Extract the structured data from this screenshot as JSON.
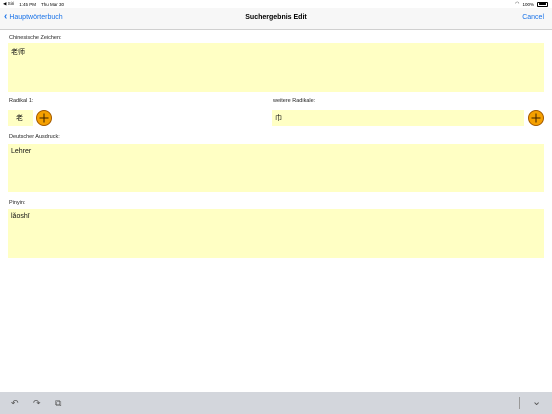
{
  "status_bar": {
    "carrier": "◀ Siri",
    "time": "1:45 PM",
    "date": "Thu Mar 30",
    "battery": "100%"
  },
  "nav": {
    "back_label": "Hauptwörterbuch",
    "title": "Suchergebnis Edit",
    "cancel_label": "Cancel"
  },
  "form": {
    "chinese_label": "Chinesische Zeichen:",
    "chinese_value": "老师",
    "radical1_label": "Radikal 1:",
    "radical1_value": "老",
    "more_radicals_label": "weitere Radikale:",
    "more_radicals_value": "巾",
    "german_label": "Deutscher Ausdruck:",
    "german_value": "Lehrer",
    "pinyin_label": "Pinyin:",
    "pinyin_value": "lǎoshī"
  },
  "toolbar": {
    "undo_icon": "↶",
    "redo_icon": "↷",
    "paste_icon": "⧉",
    "dismiss_icon": "⌄"
  },
  "colors": {
    "field_bg": "#ffffc4",
    "accent": "#1a73e8",
    "add_button": "#f5a000"
  }
}
